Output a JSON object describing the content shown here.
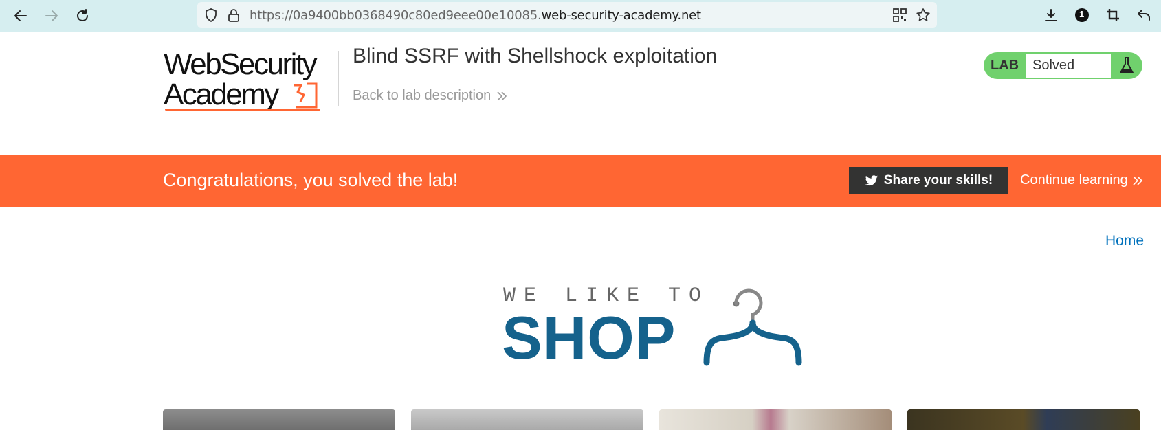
{
  "browser": {
    "url_prefix": "https://0a9400bb0368490c80ed9eee00e10085.",
    "url_domain": "web-security-academy.net",
    "extension_badge": "1"
  },
  "header": {
    "logo_line1": "WebSecurity",
    "logo_line2": "Academy",
    "lab_title": "Blind SSRF with Shellshock exploitation",
    "back_link": "Back to lab description",
    "lab_label": "LAB",
    "lab_status": "Solved"
  },
  "banner": {
    "message": "Congratulations, you solved the lab!",
    "share_button": "Share your skills!",
    "continue_link": "Continue learning"
  },
  "shop": {
    "home_link": "Home",
    "logo_small": "WE LIKE TO",
    "logo_big": "SHOP"
  },
  "colors": {
    "accent_orange": "#ff6633",
    "lab_green": "#70d16d",
    "shop_blue": "#15628c",
    "link_blue": "#0071bc"
  }
}
